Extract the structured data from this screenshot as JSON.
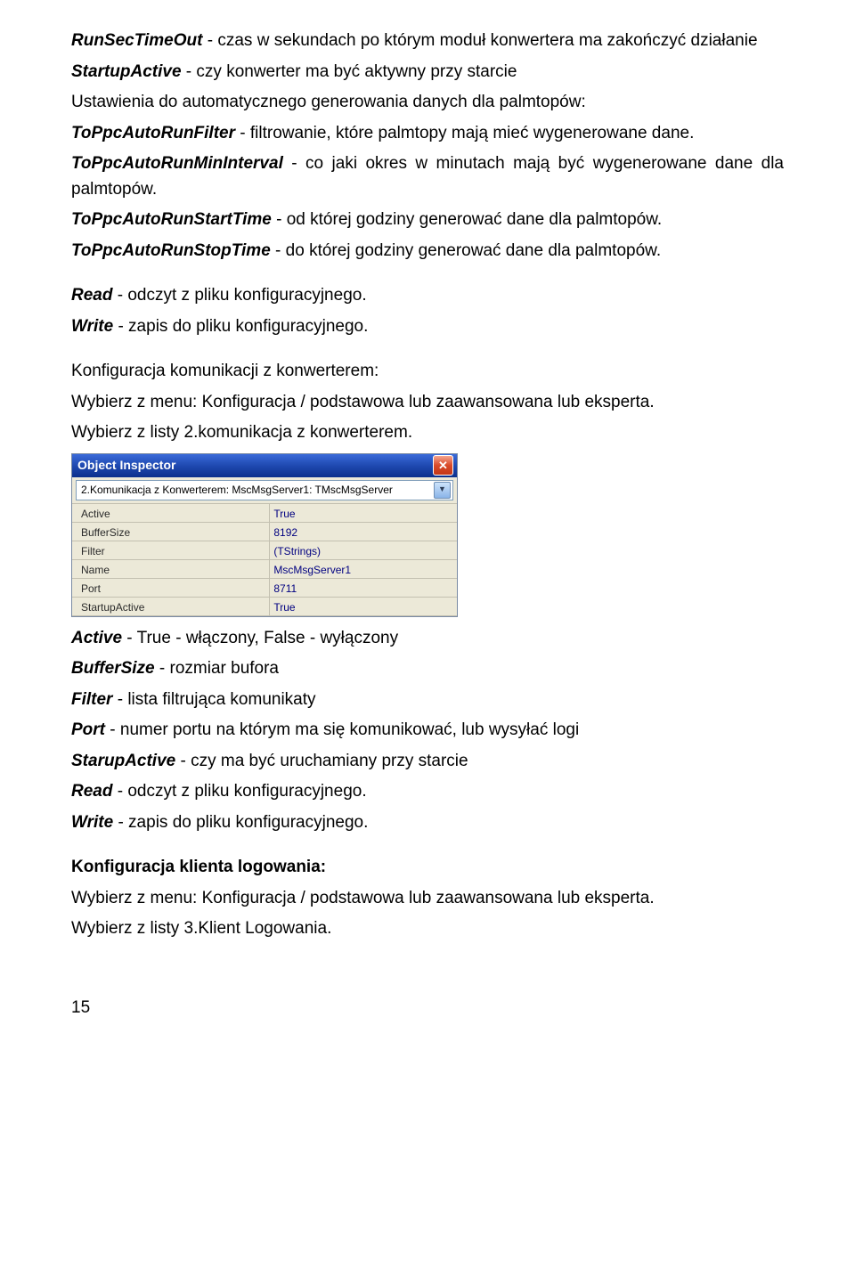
{
  "p1": {
    "term": "RunSecTimeOut",
    "rest": " - czas w sekundach po którym moduł konwertera ma zakończyć działanie"
  },
  "p2": {
    "term": "StartupActive",
    "rest": " - czy konwerter ma być aktywny przy starcie"
  },
  "p3": "Ustawienia do automatycznego generowania danych dla palmtopów:",
  "p4": {
    "term": "ToPpcAutoRunFilter",
    "rest": " - filtrowanie, które palmtopy mają mieć wygenerowane dane."
  },
  "p5": {
    "term": "ToPpcAutoRunMinInterval",
    "rest": " - co jaki okres w minutach mają być wygenerowane dane dla palmtopów."
  },
  "p6": {
    "term": "ToPpcAutoRunStartTime",
    "rest": " - od której godziny generować dane dla palmtopów."
  },
  "p7": {
    "term": "ToPpcAutoRunStopTime",
    "rest": " - do której godziny generować dane dla palmtopów."
  },
  "p8": {
    "term": "Read",
    "rest": " - odczyt z pliku konfiguracyjnego."
  },
  "p9": {
    "term": "Write",
    "rest": " - zapis do pliku konfiguracyjnego."
  },
  "p10": "Konfiguracja komunikacji z konwerterem:",
  "p11": "Wybierz z menu: Konfiguracja / podstawowa lub zaawansowana lub eksperta.",
  "p12": "Wybierz z listy 2.komunikacja z konwerterem.",
  "inspector": {
    "title": "Object Inspector",
    "dropdown": "2.Komunikacja z Konwerterem: MscMsgServer1: TMscMsgServer",
    "rows": [
      {
        "name": "Active",
        "value": "True"
      },
      {
        "name": "BufferSize",
        "value": "8192"
      },
      {
        "name": "Filter",
        "value": "(TStrings)"
      },
      {
        "name": "Name",
        "value": "MscMsgServer1"
      },
      {
        "name": "Port",
        "value": "8711"
      },
      {
        "name": "StartupActive",
        "value": "True"
      }
    ]
  },
  "p13": {
    "term": "Active",
    "rest": " - True - włączony, False - wyłączony"
  },
  "p14": {
    "term": "BufferSize",
    "rest": " - rozmiar bufora"
  },
  "p15": {
    "term": "Filter",
    "rest": " - lista filtrująca komunikaty"
  },
  "p16": {
    "term": "Port",
    "rest": " - numer portu na którym ma się komunikować, lub wysyłać logi"
  },
  "p17": {
    "term": "StarupActive",
    "rest": " - czy ma być uruchamiany przy starcie"
  },
  "p18": {
    "term": "Read",
    "rest": " - odczyt z pliku konfiguracyjnego."
  },
  "p19": {
    "term": "Write",
    "rest": " - zapis do pliku konfiguracyjnego."
  },
  "p20": "Konfiguracja klienta logowania:",
  "p21": "Wybierz z menu: Konfiguracja / podstawowa lub zaawansowana lub eksperta.",
  "p22": "Wybierz z listy 3.Klient Logowania.",
  "pageNum": "15"
}
